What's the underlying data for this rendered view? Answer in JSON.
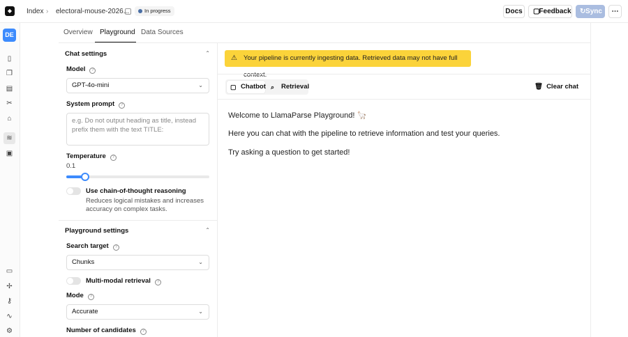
{
  "topbar": {
    "breadcrumbs": [
      "Index",
      "electoral-mouse-2026..."
    ],
    "status_badge": "In progress",
    "docs_label": "Docs",
    "feedback_label": "Feedback",
    "sync_label": "Sync",
    "more_label": "⋯"
  },
  "rail": {
    "avatar_initials": "DE",
    "icons": [
      "file-icon",
      "copy-icon",
      "document-icon",
      "scissors-icon",
      "tag-icon",
      "pipeline-icon",
      "box-icon",
      "book-icon",
      "puzzle-icon",
      "key-icon",
      "activity-icon",
      "settings-icon"
    ]
  },
  "tabs": [
    "Overview",
    "Playground",
    "Data Sources"
  ],
  "chat_settings": {
    "title": "Chat settings",
    "model_label": "Model",
    "model_value": "GPT-4o-mini",
    "system_prompt_label": "System prompt",
    "system_prompt_placeholder": "e.g. Do not output heading as title, instead prefix them with the text TITLE:",
    "temperature_label": "Temperature",
    "temperature_value": "0.1",
    "temperature_fraction": 0.1,
    "cot_label": "Use chain-of-thought reasoning",
    "cot_description": "Reduces logical mistakes and increases accuracy on complex tasks."
  },
  "playground_settings": {
    "title": "Playground settings",
    "search_target_label": "Search target",
    "search_target_value": "Chunks",
    "multimodal_label": "Multi-modal retrieval",
    "mode_label": "Mode",
    "mode_value": "Accurate",
    "candidates_label": "Number of candidates"
  },
  "main": {
    "warning": "Your pipeline is currently ingesting data. Retrieved data may not have full context.",
    "chat_tabs": [
      "Chatbot",
      "Retrieval"
    ],
    "clear_label": "Clear chat",
    "messages": [
      "Welcome to LlamaParse Playground! 🦙",
      "Here you can chat with the pipeline to retrieve information and test your queries.",
      "Try asking a question to get started!"
    ]
  },
  "colors": {
    "accent": "#3d8bfd",
    "warning": "#fbd33a"
  }
}
